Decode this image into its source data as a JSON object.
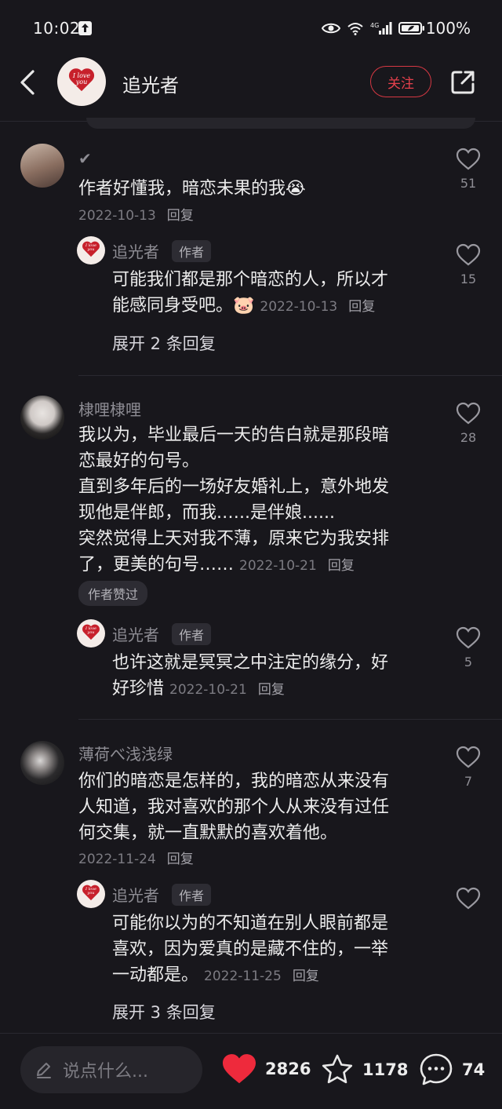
{
  "status_bar": {
    "time": "10:02",
    "battery": "100%",
    "network": "4G"
  },
  "header": {
    "avatar_text": "I love you",
    "title": "追光者",
    "follow_label": "关注"
  },
  "comments": [
    {
      "username": "✔",
      "text_lines": [
        "作者好懂我，暗恋未果的我😭"
      ],
      "date": "2022-10-13",
      "reply_label": "回复",
      "likes": "51",
      "reply": {
        "username": "追光者",
        "tag": "作者",
        "text_lines": [
          "可能我们都是那个暗恋的人，所以才",
          "能感同身受吧。🐷"
        ],
        "date": "2022-10-13",
        "reply_label": "回复",
        "likes": "15"
      },
      "expand_label": "展开 2 条回复"
    },
    {
      "username": "棣哩棣哩",
      "text_lines": [
        "我以为，毕业最后一天的告白就是那段暗",
        "恋最好的句号。",
        "直到多年后的一场好友婚礼上，意外地发",
        "现他是伴郎，而我.…..是伴娘......",
        "突然觉得上天对我不薄，原来它为我安排",
        "了，更美的句号……"
      ],
      "date": "2022-10-21",
      "reply_label": "回复",
      "likes": "28",
      "badge": "作者赞过",
      "reply": {
        "username": "追光者",
        "tag": "作者",
        "text_lines": [
          "也许这就是冥冥之中注定的缘分，好",
          "好珍惜"
        ],
        "date": "2022-10-21",
        "reply_label": "回复",
        "likes": "5"
      }
    },
    {
      "username": "薄荷べ浅浅绿",
      "text_lines": [
        "你们的暗恋是怎样的，我的暗恋从来没有",
        "人知道，我对喜欢的那个人从来没有过任",
        "何交集，就一直默默的喜欢着他。"
      ],
      "date": "2022-11-24",
      "reply_label": "回复",
      "likes": "7",
      "reply": {
        "username": "追光者",
        "tag": "作者",
        "text_lines": [
          "可能你以为的不知道在别人眼前都是",
          "喜欢，因为爱真的是藏不住的，一举",
          "一动都是。"
        ],
        "date": "2022-11-25",
        "reply_label": "回复",
        "likes": ""
      },
      "expand_label": "展开 3 条回复"
    }
  ],
  "bottom_bar": {
    "input_placeholder": "说点什么...",
    "likes": "2826",
    "favorites": "1178",
    "comments": "74"
  },
  "colors": {
    "accent": "#d63843",
    "background": "#18171c",
    "heart_red": "#ee2a3c"
  }
}
